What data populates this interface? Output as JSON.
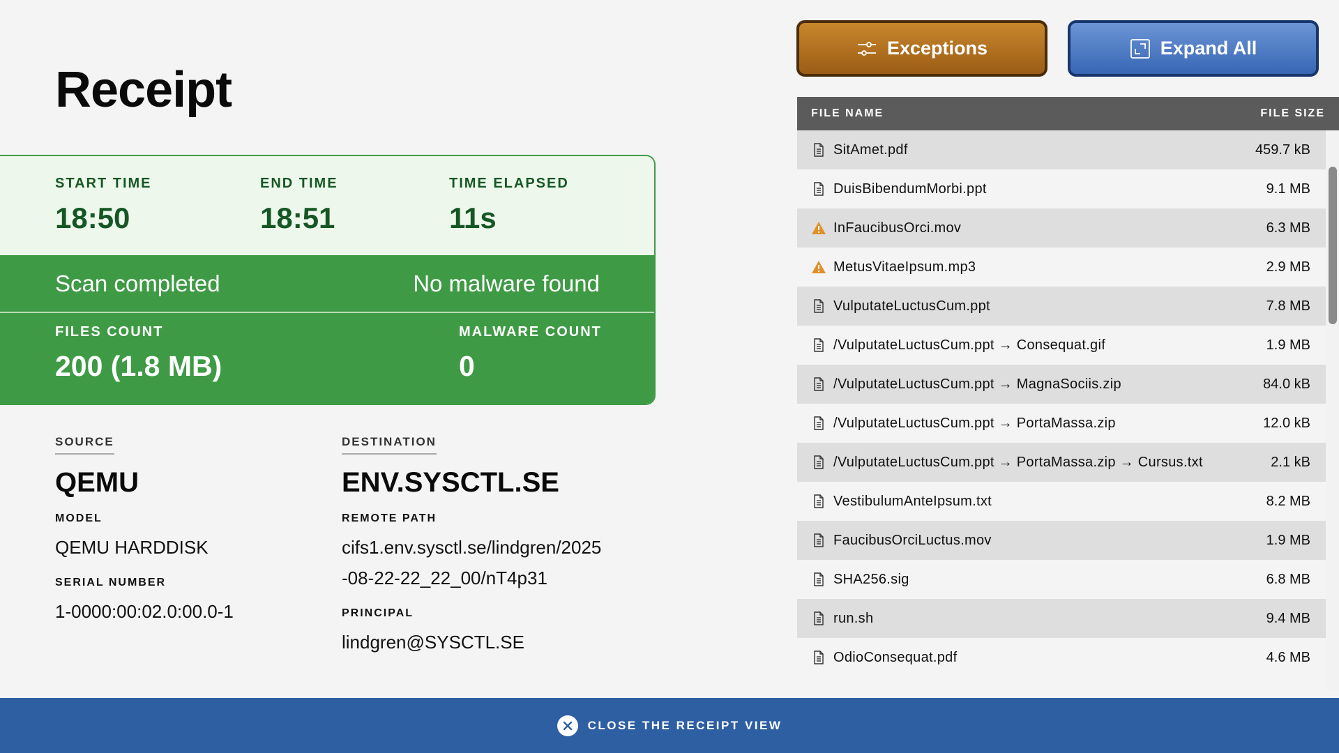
{
  "title": "Receipt",
  "summary": {
    "start_time_label": "START TIME",
    "start_time": "18:50",
    "end_time_label": "END TIME",
    "end_time": "18:51",
    "elapsed_label": "TIME ELAPSED",
    "elapsed": "11s",
    "status": "Scan completed",
    "result": "No malware found",
    "files_count_label": "FILES COUNT",
    "files_count": "200 (1.8 MB)",
    "malware_count_label": "MALWARE COUNT",
    "malware_count": "0"
  },
  "source": {
    "heading": "SOURCE",
    "name": "QEMU",
    "model_label": "MODEL",
    "model": "QEMU HARDDISK",
    "serial_label": "SERIAL NUMBER",
    "serial": "1-0000:00:02.0:00.0-1"
  },
  "destination": {
    "heading": "DESTINATION",
    "name": "ENV.SYSCTL.SE",
    "remote_path_label": "REMOTE PATH",
    "remote_path": "cifs1.env.sysctl.se/lindgren/2025-08-22-22_22_00/nT4p31",
    "principal_label": "PRINCIPAL",
    "principal": "lindgren@SYSCTL.SE"
  },
  "buttons": {
    "exceptions": "Exceptions",
    "expand_all": "Expand All"
  },
  "table": {
    "col_name": "FILE NAME",
    "col_size": "FILE SIZE",
    "rows": [
      {
        "name": "SitAmet.pdf",
        "size": "459.7 kB",
        "icon": "file-icon"
      },
      {
        "name": "DuisBibendumMorbi.ppt",
        "size": "9.1 MB",
        "icon": "file-icon"
      },
      {
        "name": "InFaucibusOrci.mov",
        "size": "6.3 MB",
        "icon": "warning-icon"
      },
      {
        "name": "MetusVitaeIpsum.mp3",
        "size": "2.9 MB",
        "icon": "warning-icon"
      },
      {
        "name": "VulputateLuctusCum.ppt",
        "size": "7.8 MB",
        "icon": "file-icon"
      },
      {
        "name": "/VulputateLuctusCum.ppt → Consequat.gif",
        "size": "1.9 MB",
        "icon": "file-icon"
      },
      {
        "name": "/VulputateLuctusCum.ppt → MagnaSociis.zip",
        "size": "84.0 kB",
        "icon": "file-icon"
      },
      {
        "name": "/VulputateLuctusCum.ppt → PortaMassa.zip",
        "size": "12.0 kB",
        "icon": "file-icon"
      },
      {
        "name": "/VulputateLuctusCum.ppt → PortaMassa.zip → Cursus.txt",
        "size": "2.1 kB",
        "icon": "file-icon"
      },
      {
        "name": "VestibulumAnteIpsum.txt",
        "size": "8.2 MB",
        "icon": "file-icon"
      },
      {
        "name": "FaucibusOrciLuctus.mov",
        "size": "1.9 MB",
        "icon": "file-icon"
      },
      {
        "name": "SHA256.sig",
        "size": "6.8 MB",
        "icon": "file-icon"
      },
      {
        "name": "run.sh",
        "size": "9.4 MB",
        "icon": "file-icon"
      },
      {
        "name": "OdioConsequat.pdf",
        "size": "4.6 MB",
        "icon": "file-icon"
      }
    ]
  },
  "footer": {
    "close_label": "CLOSE THE RECEIPT VIEW"
  },
  "colors": {
    "success": "#3f9a45",
    "exceptions_button": "#b4731f",
    "expand_button": "#4f7dc6",
    "footer": "#2e5fa3",
    "warning": "#e0902a"
  }
}
